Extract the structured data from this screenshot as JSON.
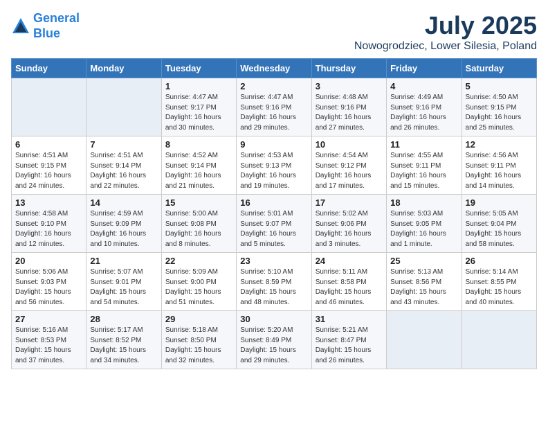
{
  "header": {
    "logo_line1": "General",
    "logo_line2": "Blue",
    "title": "July 2025",
    "subtitle": "Nowogrodziec, Lower Silesia, Poland"
  },
  "days_of_week": [
    "Sunday",
    "Monday",
    "Tuesday",
    "Wednesday",
    "Thursday",
    "Friday",
    "Saturday"
  ],
  "weeks": [
    [
      {
        "day": "",
        "info": ""
      },
      {
        "day": "",
        "info": ""
      },
      {
        "day": "1",
        "info": "Sunrise: 4:47 AM\nSunset: 9:17 PM\nDaylight: 16 hours\nand 30 minutes."
      },
      {
        "day": "2",
        "info": "Sunrise: 4:47 AM\nSunset: 9:16 PM\nDaylight: 16 hours\nand 29 minutes."
      },
      {
        "day": "3",
        "info": "Sunrise: 4:48 AM\nSunset: 9:16 PM\nDaylight: 16 hours\nand 27 minutes."
      },
      {
        "day": "4",
        "info": "Sunrise: 4:49 AM\nSunset: 9:16 PM\nDaylight: 16 hours\nand 26 minutes."
      },
      {
        "day": "5",
        "info": "Sunrise: 4:50 AM\nSunset: 9:15 PM\nDaylight: 16 hours\nand 25 minutes."
      }
    ],
    [
      {
        "day": "6",
        "info": "Sunrise: 4:51 AM\nSunset: 9:15 PM\nDaylight: 16 hours\nand 24 minutes."
      },
      {
        "day": "7",
        "info": "Sunrise: 4:51 AM\nSunset: 9:14 PM\nDaylight: 16 hours\nand 22 minutes."
      },
      {
        "day": "8",
        "info": "Sunrise: 4:52 AM\nSunset: 9:14 PM\nDaylight: 16 hours\nand 21 minutes."
      },
      {
        "day": "9",
        "info": "Sunrise: 4:53 AM\nSunset: 9:13 PM\nDaylight: 16 hours\nand 19 minutes."
      },
      {
        "day": "10",
        "info": "Sunrise: 4:54 AM\nSunset: 9:12 PM\nDaylight: 16 hours\nand 17 minutes."
      },
      {
        "day": "11",
        "info": "Sunrise: 4:55 AM\nSunset: 9:11 PM\nDaylight: 16 hours\nand 15 minutes."
      },
      {
        "day": "12",
        "info": "Sunrise: 4:56 AM\nSunset: 9:11 PM\nDaylight: 16 hours\nand 14 minutes."
      }
    ],
    [
      {
        "day": "13",
        "info": "Sunrise: 4:58 AM\nSunset: 9:10 PM\nDaylight: 16 hours\nand 12 minutes."
      },
      {
        "day": "14",
        "info": "Sunrise: 4:59 AM\nSunset: 9:09 PM\nDaylight: 16 hours\nand 10 minutes."
      },
      {
        "day": "15",
        "info": "Sunrise: 5:00 AM\nSunset: 9:08 PM\nDaylight: 16 hours\nand 8 minutes."
      },
      {
        "day": "16",
        "info": "Sunrise: 5:01 AM\nSunset: 9:07 PM\nDaylight: 16 hours\nand 5 minutes."
      },
      {
        "day": "17",
        "info": "Sunrise: 5:02 AM\nSunset: 9:06 PM\nDaylight: 16 hours\nand 3 minutes."
      },
      {
        "day": "18",
        "info": "Sunrise: 5:03 AM\nSunset: 9:05 PM\nDaylight: 16 hours\nand 1 minute."
      },
      {
        "day": "19",
        "info": "Sunrise: 5:05 AM\nSunset: 9:04 PM\nDaylight: 15 hours\nand 58 minutes."
      }
    ],
    [
      {
        "day": "20",
        "info": "Sunrise: 5:06 AM\nSunset: 9:03 PM\nDaylight: 15 hours\nand 56 minutes."
      },
      {
        "day": "21",
        "info": "Sunrise: 5:07 AM\nSunset: 9:01 PM\nDaylight: 15 hours\nand 54 minutes."
      },
      {
        "day": "22",
        "info": "Sunrise: 5:09 AM\nSunset: 9:00 PM\nDaylight: 15 hours\nand 51 minutes."
      },
      {
        "day": "23",
        "info": "Sunrise: 5:10 AM\nSunset: 8:59 PM\nDaylight: 15 hours\nand 48 minutes."
      },
      {
        "day": "24",
        "info": "Sunrise: 5:11 AM\nSunset: 8:58 PM\nDaylight: 15 hours\nand 46 minutes."
      },
      {
        "day": "25",
        "info": "Sunrise: 5:13 AM\nSunset: 8:56 PM\nDaylight: 15 hours\nand 43 minutes."
      },
      {
        "day": "26",
        "info": "Sunrise: 5:14 AM\nSunset: 8:55 PM\nDaylight: 15 hours\nand 40 minutes."
      }
    ],
    [
      {
        "day": "27",
        "info": "Sunrise: 5:16 AM\nSunset: 8:53 PM\nDaylight: 15 hours\nand 37 minutes."
      },
      {
        "day": "28",
        "info": "Sunrise: 5:17 AM\nSunset: 8:52 PM\nDaylight: 15 hours\nand 34 minutes."
      },
      {
        "day": "29",
        "info": "Sunrise: 5:18 AM\nSunset: 8:50 PM\nDaylight: 15 hours\nand 32 minutes."
      },
      {
        "day": "30",
        "info": "Sunrise: 5:20 AM\nSunset: 8:49 PM\nDaylight: 15 hours\nand 29 minutes."
      },
      {
        "day": "31",
        "info": "Sunrise: 5:21 AM\nSunset: 8:47 PM\nDaylight: 15 hours\nand 26 minutes."
      },
      {
        "day": "",
        "info": ""
      },
      {
        "day": "",
        "info": ""
      }
    ]
  ]
}
